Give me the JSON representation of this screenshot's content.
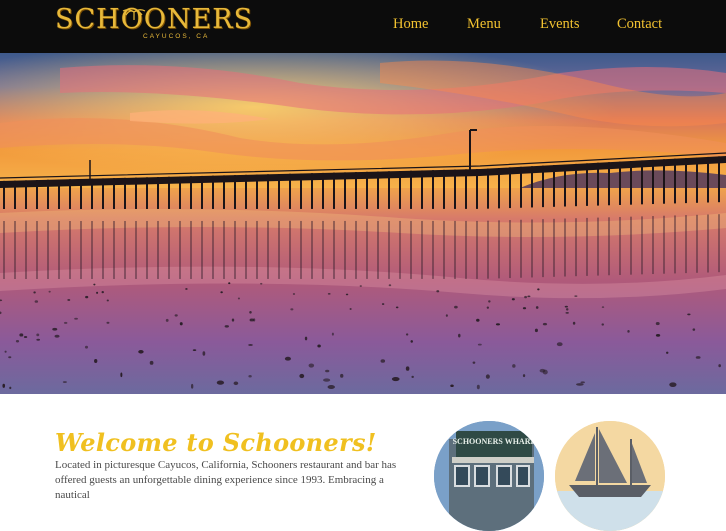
{
  "header": {
    "logo": {
      "wordmark": "SCHOONERS",
      "subtitle": "CAYUCOS, CA"
    },
    "nav": [
      {
        "label": "Home"
      },
      {
        "label": "Menu"
      },
      {
        "label": "Events"
      },
      {
        "label": "Contact"
      }
    ]
  },
  "hero": {
    "icon": "pier-sunset-photo"
  },
  "content": {
    "heading": "Welcome to Schooners!",
    "intro": "Located in picturesque Cayucos, California, Schooners restaurant and bar has offered guests an unforgettable dining experience since 1993. Embracing a nautical",
    "photos": [
      {
        "icon": "schooners-wharf-building-photo",
        "sign": "SCHOONERS WHARF"
      },
      {
        "icon": "sailing-ship-silhouette-icon"
      }
    ]
  },
  "colors": {
    "accent": "#f2c230",
    "header_bg": "#0c0c0c",
    "body_text": "#4a4a4a"
  }
}
